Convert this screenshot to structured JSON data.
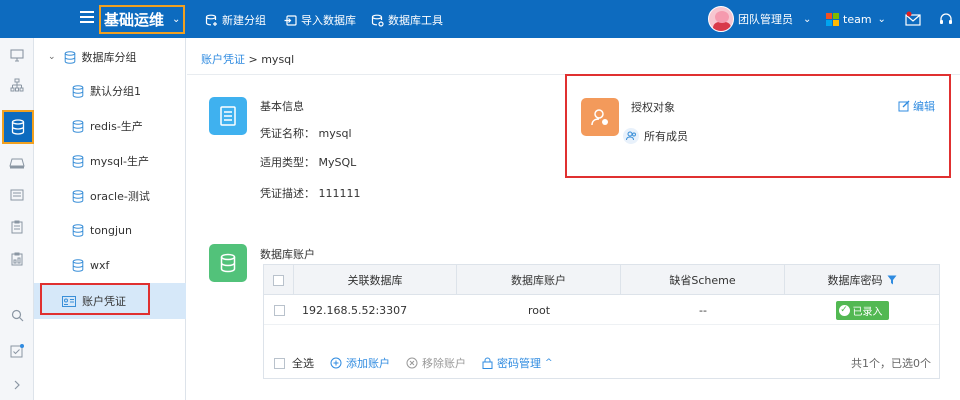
{
  "header": {
    "title": "基础运维",
    "actions": [
      {
        "label": "新建分组",
        "icon": "database-add-icon"
      },
      {
        "label": "导入数据库",
        "icon": "import-icon"
      },
      {
        "label": "数据库工具",
        "icon": "database-tool-icon"
      }
    ],
    "user_name": "团队管理员",
    "team_name": "team"
  },
  "colors": {
    "header_bg": "#0d6bbf",
    "highlight_orange": "#f0a020",
    "highlight_red": "#e03030",
    "link_blue": "#2f8be0",
    "tile_blue": "#3fb1ef",
    "tile_orange": "#f39a5b",
    "tile_green": "#52c27a",
    "badge_green": "#52b852"
  },
  "rail": {
    "items": [
      "monitor-icon",
      "org-chart-icon",
      "database-icon",
      "disk-icon",
      "list-icon",
      "clipboard-icon",
      "report-icon",
      "search-icon",
      "task-icon",
      "expand-icon"
    ]
  },
  "tree": {
    "group_label": "数据库分组",
    "items": [
      {
        "label": "默认分组1"
      },
      {
        "label": "redis-生产"
      },
      {
        "label": "mysql-生产"
      },
      {
        "label": "oracle-测试"
      },
      {
        "label": "tongjun"
      },
      {
        "label": "wxf"
      }
    ],
    "credential_label": "账户凭证"
  },
  "breadcrumb": {
    "parent": "账户凭证",
    "separator": ">",
    "current": "mysql"
  },
  "basic_info": {
    "title": "基本信息",
    "name_label": "凭证名称：",
    "name_value": "mysql",
    "type_label": "适用类型：",
    "type_value": "MySQL",
    "desc_label": "凭证描述：",
    "desc_value": "111111"
  },
  "authorization": {
    "title": "授权对象",
    "edit_label": "编辑",
    "member_label": "所有成员"
  },
  "db_accounts": {
    "title": "数据库账户",
    "columns": [
      "关联数据库",
      "数据库账户",
      "缺省Scheme",
      "数据库密码"
    ],
    "rows": [
      {
        "database": "192.168.5.52:3307",
        "account": "root",
        "scheme": "--",
        "password_status": "已录入"
      }
    ],
    "footer": {
      "select_all": "全选",
      "add": "添加账户",
      "remove": "移除账户",
      "password_mgmt": "密码管理",
      "summary": "共1个，已选0个"
    }
  }
}
